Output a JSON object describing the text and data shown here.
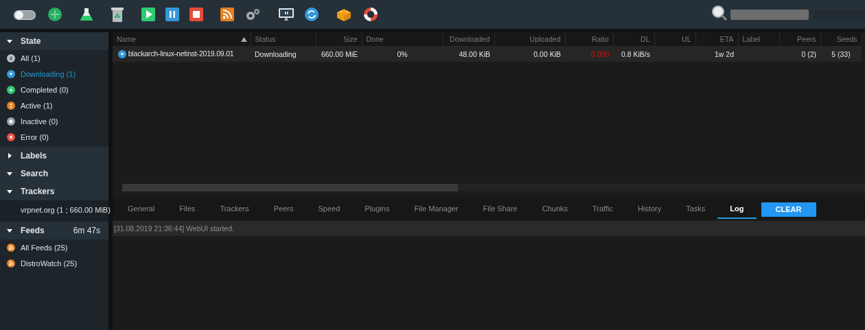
{
  "sidebar": {
    "sections": [
      {
        "title": "State",
        "expanded": true,
        "items": [
          {
            "label": "All (1)",
            "kind": "all",
            "selected": false
          },
          {
            "label": "Downloading (1)",
            "kind": "downloading",
            "selected": true
          },
          {
            "label": "Completed (0)",
            "kind": "completed",
            "selected": false
          },
          {
            "label": "Active (1)",
            "kind": "active",
            "selected": false
          },
          {
            "label": "Inactive (0)",
            "kind": "inactive",
            "selected": false
          },
          {
            "label": "Error (0)",
            "kind": "error",
            "selected": false
          }
        ]
      },
      {
        "title": "Labels",
        "expanded": false
      },
      {
        "title": "Search",
        "expanded": true
      },
      {
        "title": "Trackers",
        "expanded": true,
        "items": [
          {
            "label": "vrpnet.org (1 ; 660.00 MiB)",
            "kind": "tracker",
            "selected": false
          }
        ]
      },
      {
        "title": "Feeds",
        "expanded": true,
        "timer": "6m 47s",
        "items": [
          {
            "label": "All Feeds (25)",
            "kind": "feed",
            "selected": false
          },
          {
            "label": "DistroWatch (25)",
            "kind": "feed",
            "selected": false
          }
        ]
      }
    ]
  },
  "table": {
    "columns": [
      {
        "label": "Name",
        "sorted": true
      },
      {
        "label": "Status",
        "sorted": false
      },
      {
        "label": "Size",
        "sorted": false
      },
      {
        "label": "Done",
        "sorted": false
      },
      {
        "label": "Downloaded",
        "sorted": false
      },
      {
        "label": "Uploaded",
        "sorted": false
      },
      {
        "label": "Ratio",
        "sorted": false
      },
      {
        "label": "DL",
        "sorted": false
      },
      {
        "label": "UL",
        "sorted": false
      },
      {
        "label": "ETA",
        "sorted": false
      },
      {
        "label": "Label",
        "sorted": false
      },
      {
        "label": "Peers",
        "sorted": false
      },
      {
        "label": "Seeds",
        "sorted": false
      }
    ],
    "rows": [
      {
        "kind": "downloading",
        "cells": [
          "blackarch-linux-netinst-2019.09.01",
          "Downloading",
          "660.00 MiE",
          "0%",
          "48.00 KiB",
          "0.00 KiB",
          "0.000",
          "0.8 KiB/s",
          "",
          "1w 2d",
          "",
          "0 (2)",
          "5 (33)"
        ]
      }
    ]
  },
  "details": {
    "tabs": [
      {
        "label": "General",
        "selected": false
      },
      {
        "label": "Files",
        "selected": false
      },
      {
        "label": "Trackers",
        "selected": false
      },
      {
        "label": "Peers",
        "selected": false
      },
      {
        "label": "Speed",
        "selected": false
      },
      {
        "label": "Plugins",
        "selected": false
      },
      {
        "label": "File Manager",
        "selected": false
      },
      {
        "label": "File Share",
        "selected": false
      },
      {
        "label": "Chunks",
        "selected": false
      },
      {
        "label": "Traffic",
        "selected": false
      },
      {
        "label": "History",
        "selected": false
      },
      {
        "label": "Tasks",
        "selected": false
      },
      {
        "label": "Log",
        "selected": true
      }
    ],
    "clear_button": "CLEAR",
    "log": [
      "[31.08.2019 21:36:44] WebUI started."
    ]
  }
}
